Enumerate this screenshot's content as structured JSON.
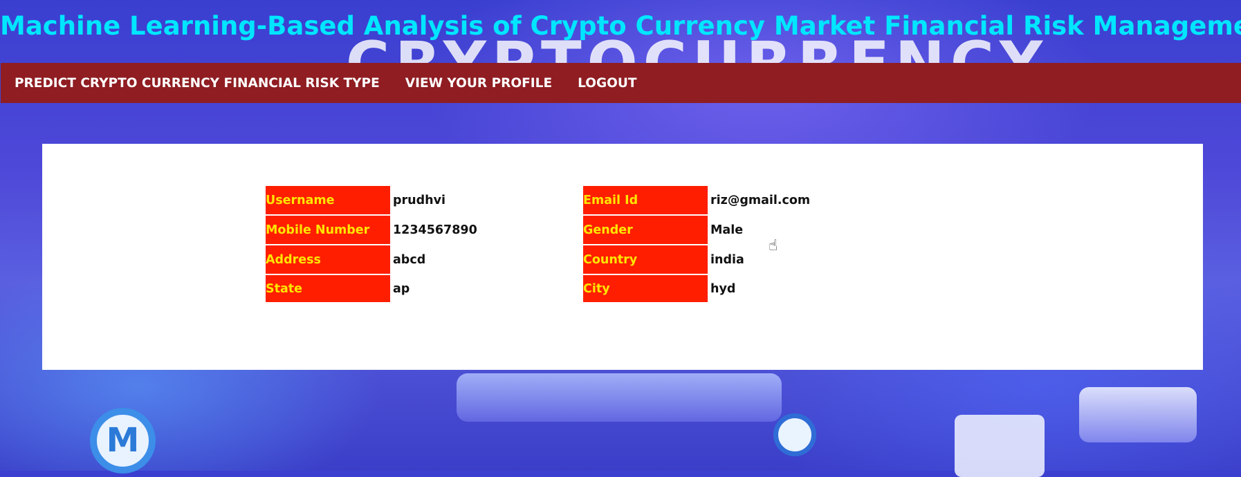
{
  "header": {
    "title": "Machine Learning-Based Analysis of Crypto Currency Market Financial Risk Management",
    "background_word": "CRYPTOCURRENCY"
  },
  "nav": {
    "items": [
      {
        "label": "PREDICT CRYPTO CURRENCY FINANCIAL RISK TYPE"
      },
      {
        "label": "VIEW YOUR PROFILE"
      },
      {
        "label": "LOGOUT"
      }
    ]
  },
  "profile": {
    "rows": [
      {
        "label_left": "Username",
        "value_left": "prudhvi",
        "label_right": "Email Id",
        "value_right": "riz@gmail.com"
      },
      {
        "label_left": "Mobile Number",
        "value_left": "1234567890",
        "label_right": "Gender",
        "value_right": "Male"
      },
      {
        "label_left": "Address",
        "value_left": "abcd",
        "label_right": "Country",
        "value_right": "india"
      },
      {
        "label_left": "State",
        "value_left": "ap",
        "label_right": "City",
        "value_right": "hyd"
      }
    ]
  },
  "colors": {
    "title": "#00e6ff",
    "navbar": "#8f1d22",
    "label_bg": "#ff1e00",
    "label_text": "#ffe600"
  },
  "icons": {
    "cursor": "hand-pointer-icon"
  }
}
